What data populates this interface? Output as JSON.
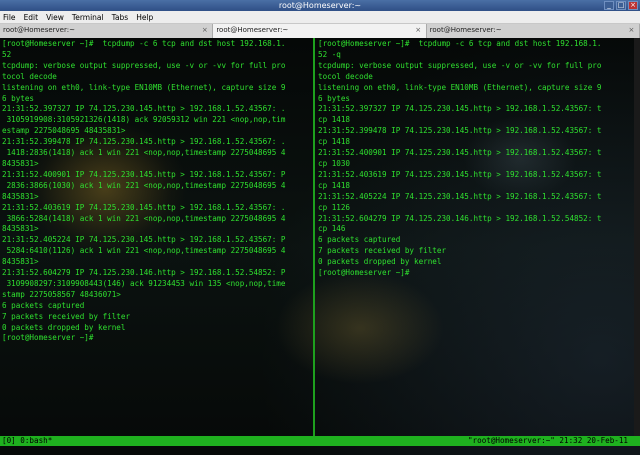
{
  "window": {
    "title": "root@Homeserver:~",
    "minimize_glyph": "_",
    "maximize_glyph": "□",
    "close_glyph": "×"
  },
  "menu": [
    "File",
    "Edit",
    "View",
    "Terminal",
    "Tabs",
    "Help"
  ],
  "tabs": [
    {
      "label": "root@Homeserver:~",
      "close": "×"
    },
    {
      "label": "root@Homeserver:~",
      "close": "×"
    },
    {
      "label": "root@Homeserver:~",
      "close": "×"
    }
  ],
  "left_pane": [
    "[root@Homeserver ~]#  tcpdump -c 6 tcp and dst host 192.168.1.",
    "52",
    "tcpdump: verbose output suppressed, use -v or -vv for full pro",
    "tocol decode",
    "listening on eth0, link-type EN10MB (Ethernet), capture size 9",
    "6 bytes",
    "21:31:52.397327 IP 74.125.230.145.http > 192.168.1.52.43567: .",
    " 3105919908:3105921326(1418) ack 92059312 win 221 <nop,nop,tim",
    "estamp 2275048695 48435831>",
    "21:31:52.399478 IP 74.125.230.145.http > 192.168.1.52.43567: .",
    " 1418:2836(1418) ack 1 win 221 <nop,nop,timestamp 2275048695 4",
    "8435831>",
    "21:31:52.400901 IP 74.125.230.145.http > 192.168.1.52.43567: P",
    " 2836:3866(1030) ack 1 win 221 <nop,nop,timestamp 2275048695 4",
    "8435831>",
    "21:31:52.403619 IP 74.125.230.145.http > 192.168.1.52.43567: .",
    " 3866:5284(1418) ack 1 win 221 <nop,nop,timestamp 2275048695 4",
    "8435831>",
    "21:31:52.405224 IP 74.125.230.145.http > 192.168.1.52.43567: P",
    " 5284:6410(1126) ack 1 win 221 <nop,nop,timestamp 2275048695 4",
    "8435831>",
    "21:31:52.604279 IP 74.125.230.146.http > 192.168.1.52.54852: P",
    " 3109908297:3109908443(146) ack 91234453 win 135 <nop,nop,time",
    "stamp 2275058567 48436071>",
    "6 packets captured",
    "7 packets received by filter",
    "0 packets dropped by kernel",
    "[root@Homeserver ~]# "
  ],
  "right_pane": [
    "[root@Homeserver ~]#  tcpdump -c 6 tcp and dst host 192.168.1.",
    "52 -q",
    "tcpdump: verbose output suppressed, use -v or -vv for full pro",
    "tocol decode",
    "listening on eth0, link-type EN10MB (Ethernet), capture size 9",
    "6 bytes",
    "21:31:52.397327 IP 74.125.230.145.http > 192.168.1.52.43567: t",
    "cp 1418",
    "21:31:52.399478 IP 74.125.230.145.http > 192.168.1.52.43567: t",
    "cp 1418",
    "21:31:52.400901 IP 74.125.230.145.http > 192.168.1.52.43567: t",
    "cp 1030",
    "21:31:52.403619 IP 74.125.230.145.http > 192.168.1.52.43567: t",
    "cp 1418",
    "21:31:52.405224 IP 74.125.230.145.http > 192.168.1.52.43567: t",
    "cp 1126",
    "21:31:52.604279 IP 74.125.230.146.http > 192.168.1.52.54852: t",
    "cp 146",
    "6 packets captured",
    "7 packets received by filter",
    "0 packets dropped by kernel",
    "[root@Homeserver ~]# "
  ],
  "status": {
    "left": "[0] 0:bash*",
    "right": "\"root@Homeserver:~\" 21:32 20-Feb-11"
  },
  "colors": {
    "terminal_text": "#2fe02f",
    "status_bar": "#1fb11f",
    "pane_divider": "#1ea01e"
  }
}
